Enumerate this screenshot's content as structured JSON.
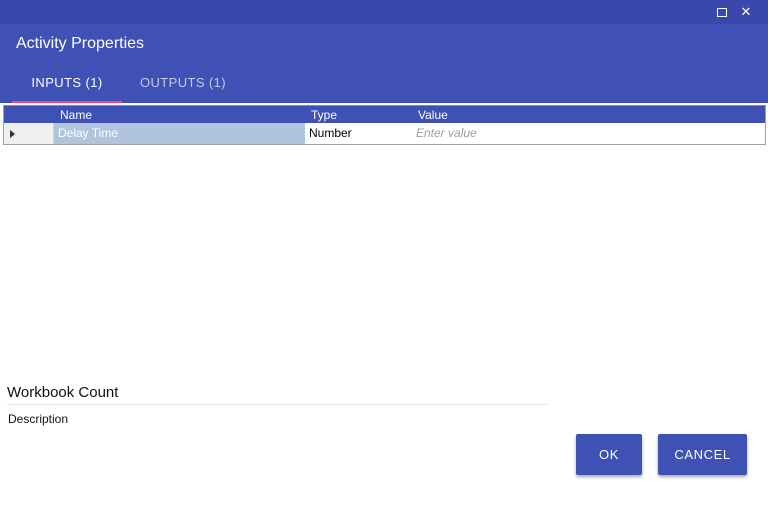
{
  "window": {
    "maximize_icon": "maximize-icon",
    "close_glyph": "✕"
  },
  "dialog": {
    "title": "Activity Properties"
  },
  "tabs": [
    {
      "label": "INPUTS (1)",
      "active": true
    },
    {
      "label": "OUTPUTS (1)",
      "active": false
    }
  ],
  "grid": {
    "columns": [
      "Name",
      "Type",
      "Value"
    ],
    "rows": [
      {
        "name": "Delay Time",
        "type": "Number",
        "value_placeholder": "Enter value"
      }
    ]
  },
  "footer": {
    "activity_name": "Workbook Count",
    "description_label": "Description"
  },
  "buttons": {
    "ok": "OK",
    "cancel": "CANCEL"
  },
  "colors": {
    "primary": "#3f51b5",
    "titlebar": "#3949ab",
    "tab_indicator": "#ff4081",
    "selected_cell": "#b0c4de"
  }
}
